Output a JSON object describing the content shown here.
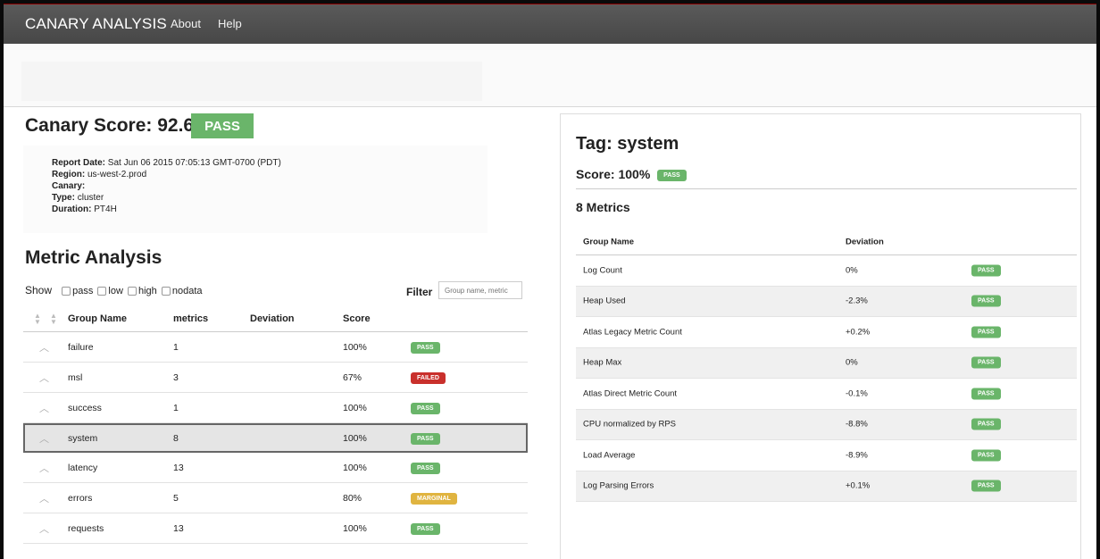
{
  "navbar": {
    "brand": "CANARY ANALYSIS",
    "links": [
      "About",
      "Help"
    ]
  },
  "summary": {
    "title": "Canary Score: 92.6%",
    "result": "PASS",
    "report_date_label": "Report Date:",
    "report_date": "Sat Jun 06 2015 07:05:13 GMT-0700 (PDT)",
    "region_label": "Region:",
    "region": "us-west-2.prod",
    "canary_label": "Canary:",
    "canary": "",
    "type_label": "Type:",
    "type": "cluster",
    "duration_label": "Duration:",
    "duration": "PT4H"
  },
  "metric_analysis": {
    "title": "Metric Analysis",
    "show_label": "Show",
    "filters": [
      "pass",
      "low",
      "high",
      "nodata"
    ],
    "filter_label": "Filter",
    "filter_placeholder": "Group name, metric",
    "columns": [
      "Group Name",
      "metrics",
      "Deviation",
      "Score"
    ],
    "rows": [
      {
        "group": "failure",
        "metrics": "1",
        "deviation": "",
        "score": "100%",
        "status": "PASS",
        "kind": "pass",
        "selected": false
      },
      {
        "group": "msl",
        "metrics": "3",
        "deviation": "",
        "score": "67%",
        "status": "FAILED",
        "kind": "failed",
        "selected": false
      },
      {
        "group": "success",
        "metrics": "1",
        "deviation": "",
        "score": "100%",
        "status": "PASS",
        "kind": "pass",
        "selected": false
      },
      {
        "group": "system",
        "metrics": "8",
        "deviation": "",
        "score": "100%",
        "status": "PASS",
        "kind": "pass",
        "selected": true
      },
      {
        "group": "latency",
        "metrics": "13",
        "deviation": "",
        "score": "100%",
        "status": "PASS",
        "kind": "pass",
        "selected": false
      },
      {
        "group": "errors",
        "metrics": "5",
        "deviation": "",
        "score": "80%",
        "status": "MARGINAL",
        "kind": "marginal",
        "selected": false
      },
      {
        "group": "requests",
        "metrics": "13",
        "deviation": "",
        "score": "100%",
        "status": "PASS",
        "kind": "pass",
        "selected": false
      }
    ]
  },
  "tag_detail": {
    "title": "Tag: system",
    "score": "Score: 100%",
    "score_status": "PASS",
    "metrics_count": "8 Metrics",
    "columns": [
      "Group Name",
      "Deviation"
    ],
    "rows": [
      {
        "name": "Log Count",
        "deviation": "0%",
        "status": "PASS"
      },
      {
        "name": "Heap Used",
        "deviation": "-2.3%",
        "status": "PASS"
      },
      {
        "name": "Atlas Legacy Metric Count",
        "deviation": "+0.2%",
        "status": "PASS"
      },
      {
        "name": "Heap Max",
        "deviation": "0%",
        "status": "PASS"
      },
      {
        "name": "Atlas Direct Metric Count",
        "deviation": "-0.1%",
        "status": "PASS"
      },
      {
        "name": "CPU normalized by RPS",
        "deviation": "-8.8%",
        "status": "PASS"
      },
      {
        "name": "Load Average",
        "deviation": "-8.9%",
        "status": "PASS"
      },
      {
        "name": "Log Parsing Errors",
        "deviation": "+0.1%",
        "status": "PASS"
      }
    ]
  },
  "colors": {
    "pass": "#6ab56a",
    "failed": "#c9302c",
    "marginal": "#e0b440",
    "navbar": "#4f4f4f"
  },
  "icons": {
    "row_expand": "chevron-up-icon",
    "sort": "sort-icon"
  }
}
